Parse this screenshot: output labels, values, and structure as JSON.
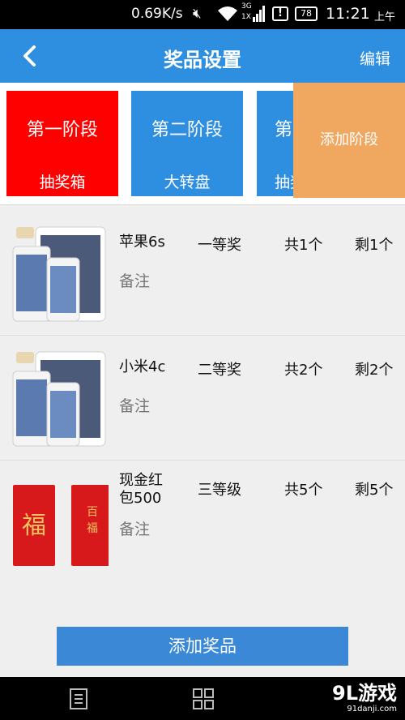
{
  "status_bar": {
    "speed": "0.69K/s",
    "network_top": "3G",
    "network_bottom": "1X",
    "alert": "!",
    "battery": "78",
    "time": "11:21",
    "ampm": "上午"
  },
  "header": {
    "title": "奖品设置",
    "edit_label": "编辑"
  },
  "stages": [
    {
      "name": "第一阶段",
      "type": "抽奖箱",
      "color": "#ff0000"
    },
    {
      "name": "第二阶段",
      "type": "大转盘",
      "color": "#2e8fe0"
    },
    {
      "name": "第三阶段",
      "type": "抽奖箱",
      "color": "#2e8fe0"
    }
  ],
  "add_stage_label": "添加阶段",
  "prizes": [
    {
      "name": "苹果6s",
      "level": "一等奖",
      "total": "共1个",
      "remaining": "剩1个",
      "note": "备注"
    },
    {
      "name": "小米4c",
      "level": "二等奖",
      "total": "共2个",
      "remaining": "剩2个",
      "note": "备注"
    },
    {
      "name": "现金红包500",
      "level": "三等级",
      "total": "共5个",
      "remaining": "剩5个",
      "note": "备注"
    }
  ],
  "add_prize_label": "添加奖品",
  "watermark": {
    "main": "9L游戏",
    "sub": "91danji.com"
  }
}
